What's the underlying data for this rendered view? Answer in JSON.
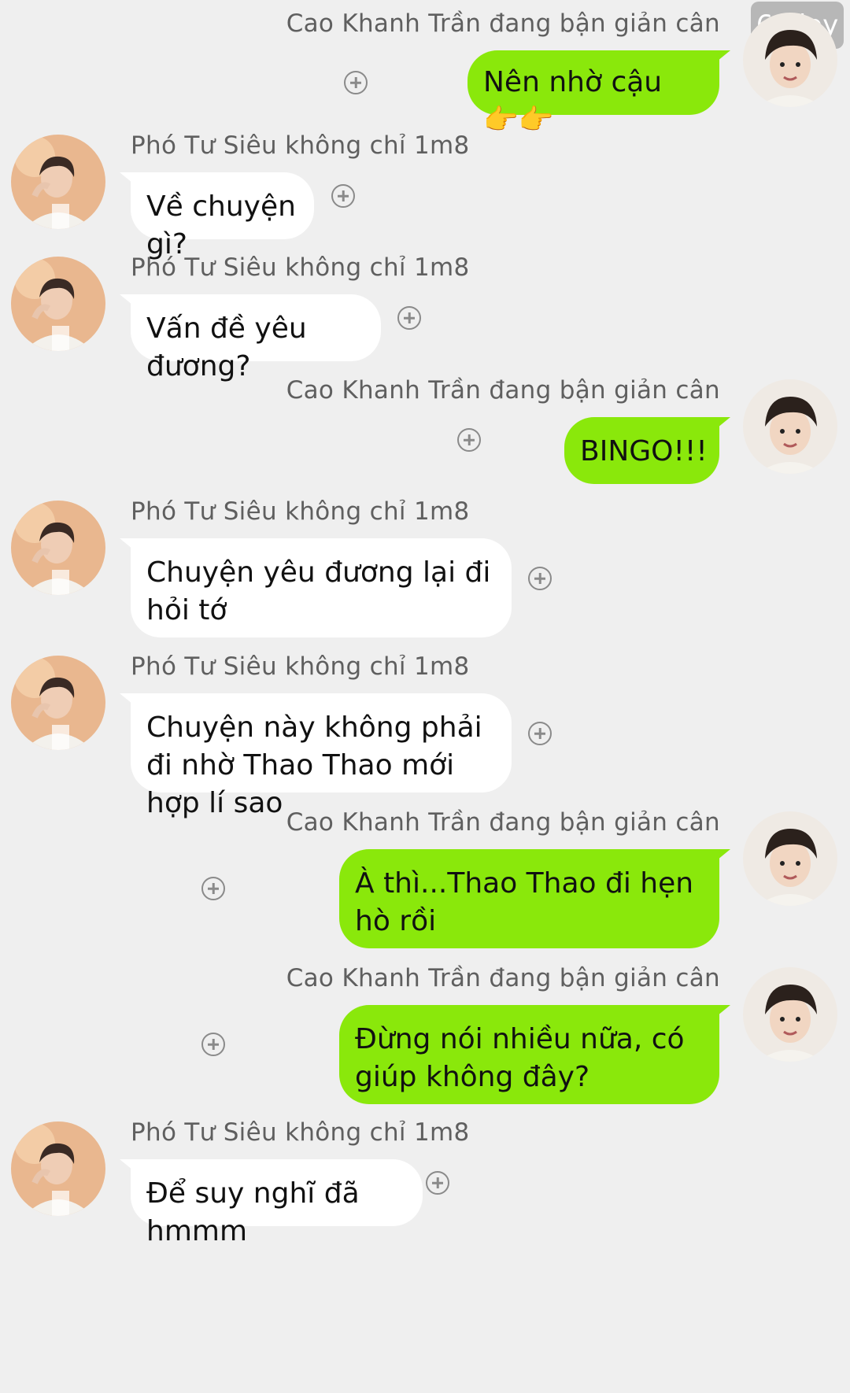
{
  "watermark": "68 joy",
  "messages": [
    {
      "side": "right",
      "sender": "Cao Khanh Trần đang bận giản cân",
      "text": "Nên nhờ cậu 👉👉"
    },
    {
      "side": "left",
      "sender": "Phó Tư Siêu không chỉ 1m8",
      "text": "Về chuyện gì?"
    },
    {
      "side": "left",
      "sender": "Phó Tư Siêu không chỉ 1m8",
      "text": "Vấn đề yêu đương?"
    },
    {
      "side": "right",
      "sender": "Cao Khanh Trần đang bận giản cân",
      "text": "BINGO!!!"
    },
    {
      "side": "left",
      "sender": "Phó Tư Siêu không chỉ 1m8",
      "text": "Chuyện yêu đương lại đi hỏi tớ"
    },
    {
      "side": "left",
      "sender": "Phó Tư Siêu không chỉ 1m8",
      "text": "Chuyện này không phải đi nhờ Thao Thao mới hợp lí sao"
    },
    {
      "side": "right",
      "sender": "Cao Khanh Trần đang bận giản cân",
      "text": "À thì...Thao Thao đi hẹn hò rồi"
    },
    {
      "side": "right",
      "sender": "Cao Khanh Trần đang bận giản cân",
      "text": "Đừng nói nhiều nữa, có giúp không đây?"
    },
    {
      "side": "left",
      "sender": "Phó Tư Siêu không chỉ 1m8",
      "text": "Để suy nghĩ đã hmmm"
    }
  ],
  "colors": {
    "background": "#efefef",
    "outgoing_bubble": "#8ae80b",
    "incoming_bubble": "#ffffff",
    "sender_name": "#5f5f5f"
  },
  "icons": {
    "add": "plus-circle-icon",
    "avatar_right": "avatar-boy-dark-hair",
    "avatar_left": "avatar-boy-warm-tone"
  }
}
